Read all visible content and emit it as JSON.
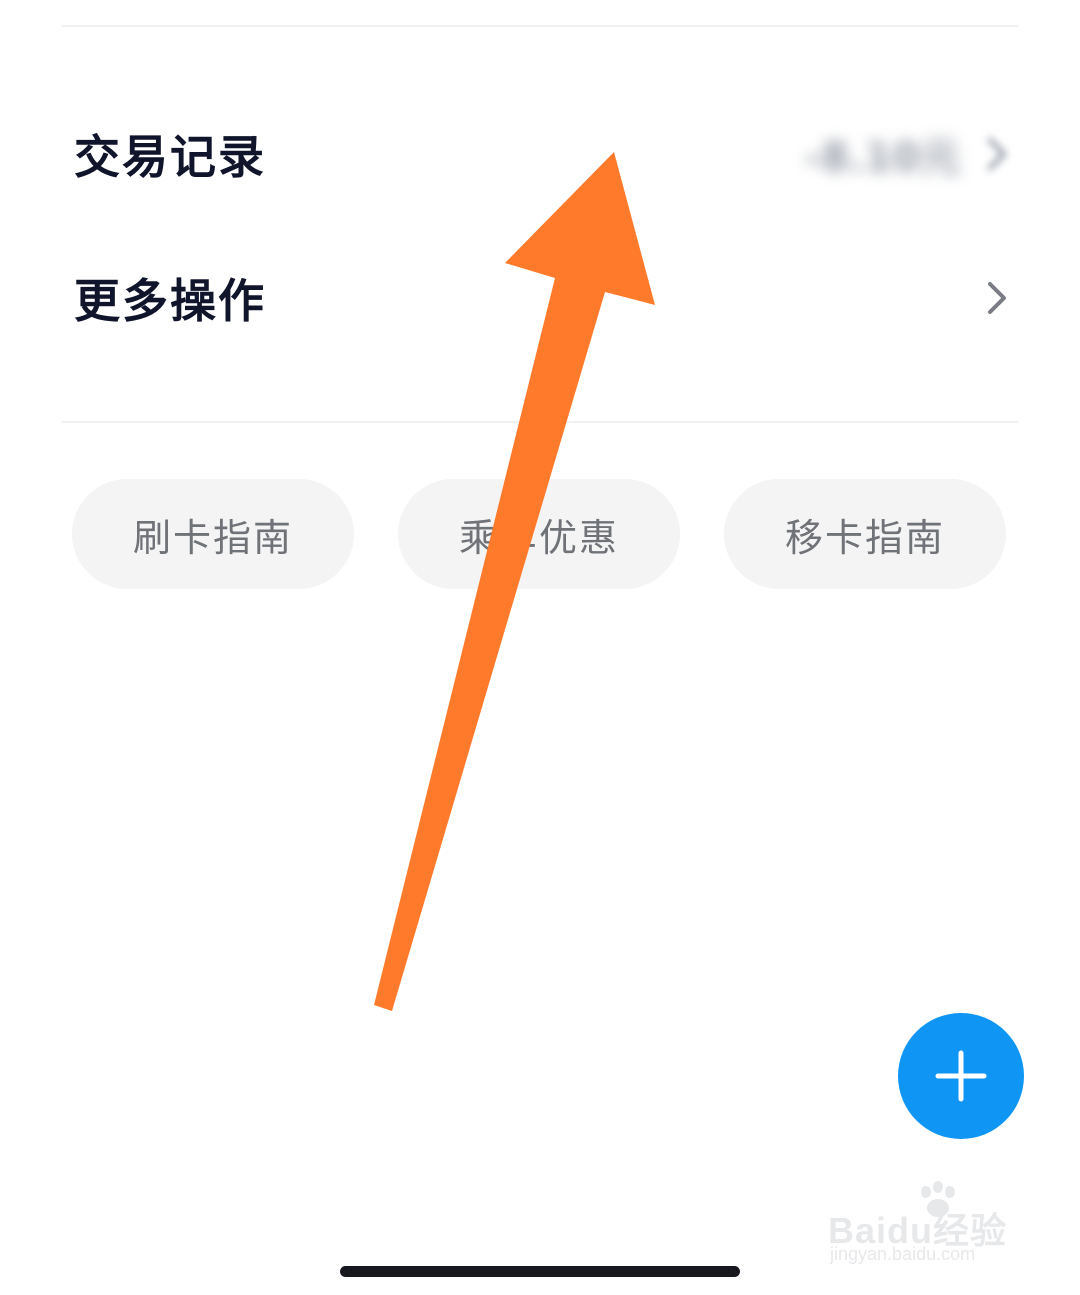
{
  "rows": {
    "transactions": {
      "label": "交易记录",
      "amount": "-8.10元"
    },
    "more": {
      "label": "更多操作"
    }
  },
  "chips": [
    {
      "label": "刷卡指南"
    },
    {
      "label": "乘车优惠"
    },
    {
      "label": "移卡指南"
    }
  ],
  "fab": {
    "icon": "plus-icon"
  },
  "icons": {
    "chevron": "chevron-right-icon",
    "paw": "paw-icon"
  },
  "watermark": {
    "brand": "Baidu经验",
    "url": "jingyan.baidu.com"
  },
  "colors": {
    "accent": "#0f96f5",
    "annotation_arrow": "#ff7a2a",
    "text_primary": "#11152b",
    "chip_bg": "#f4f4f5",
    "chip_text": "#6f7277"
  }
}
